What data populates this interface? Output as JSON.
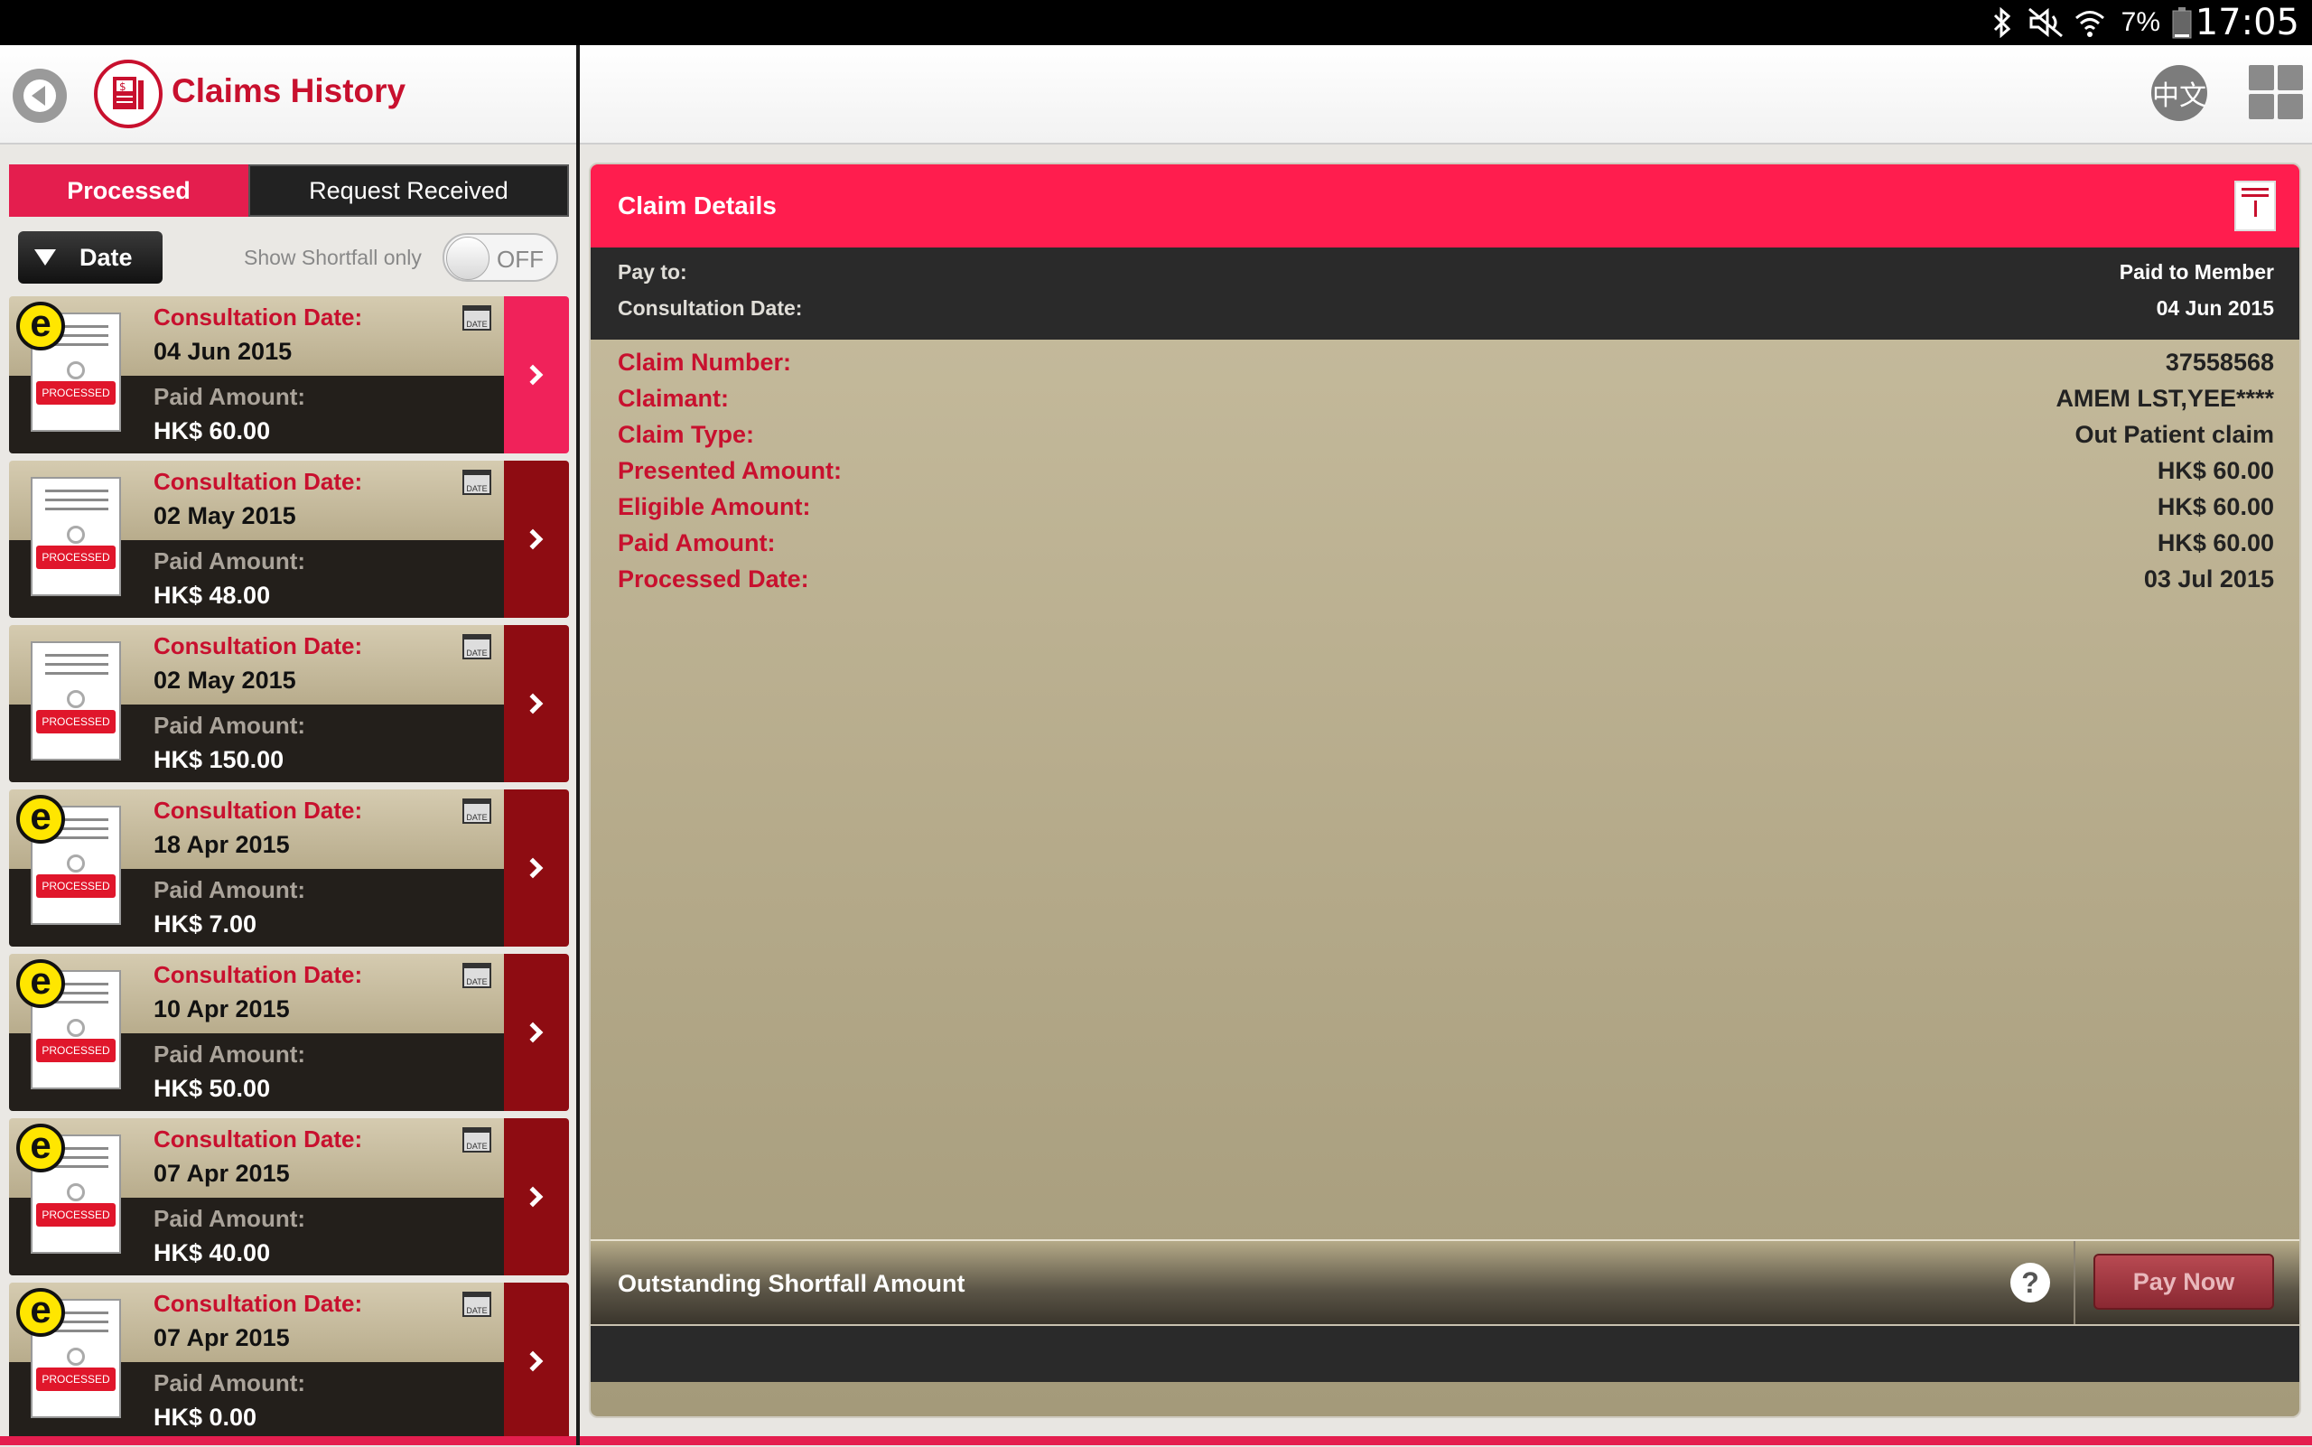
{
  "status_bar": {
    "time": "17:05",
    "battery_percent": "7%",
    "icons": [
      "bluetooth-icon",
      "mute-icon",
      "wifi-icon",
      "battery-icon"
    ]
  },
  "header": {
    "title": "Claims History",
    "lang_button": "中文"
  },
  "tabs": {
    "processed": "Processed",
    "request_received": "Request Received"
  },
  "filters": {
    "sort_label": "Date",
    "shortfall_label": "Show Shortfall only",
    "shortfall_toggle": "OFF"
  },
  "claims": [
    {
      "consultation_label": "Consultation Date:",
      "date": "04 Jun 2015",
      "paid_label": "Paid Amount:",
      "amount": "HK$ 60.00",
      "e_claim": true,
      "selected": true,
      "stamp": "PROCESSED",
      "cal": "DATE"
    },
    {
      "consultation_label": "Consultation Date:",
      "date": "02 May 2015",
      "paid_label": "Paid Amount:",
      "amount": "HK$ 48.00",
      "e_claim": false,
      "selected": false,
      "stamp": "PROCESSED",
      "cal": "DATE"
    },
    {
      "consultation_label": "Consultation Date:",
      "date": "02 May 2015",
      "paid_label": "Paid Amount:",
      "amount": "HK$ 150.00",
      "e_claim": false,
      "selected": false,
      "stamp": "PROCESSED",
      "cal": "DATE"
    },
    {
      "consultation_label": "Consultation Date:",
      "date": "18 Apr 2015",
      "paid_label": "Paid Amount:",
      "amount": "HK$ 7.00",
      "e_claim": true,
      "selected": false,
      "stamp": "PROCESSED",
      "cal": "DATE"
    },
    {
      "consultation_label": "Consultation Date:",
      "date": "10 Apr 2015",
      "paid_label": "Paid Amount:",
      "amount": "HK$ 50.00",
      "e_claim": true,
      "selected": false,
      "stamp": "PROCESSED",
      "cal": "DATE"
    },
    {
      "consultation_label": "Consultation Date:",
      "date": "07 Apr 2015",
      "paid_label": "Paid Amount:",
      "amount": "HK$ 40.00",
      "e_claim": true,
      "selected": false,
      "stamp": "PROCESSED",
      "cal": "DATE"
    },
    {
      "consultation_label": "Consultation Date:",
      "date": "07 Apr 2015",
      "paid_label": "Paid Amount:",
      "amount": "HK$ 0.00",
      "e_claim": true,
      "selected": false,
      "stamp": "PROCESSED",
      "cal": "DATE"
    }
  ],
  "details": {
    "title": "Claim Details",
    "pay_to_label": "Pay to:",
    "pay_to_value": "Paid to Member",
    "consultation_label": "Consultation Date:",
    "consultation_value": "04 Jun 2015",
    "rows": [
      {
        "label": "Claim Number:",
        "value": "37558568"
      },
      {
        "label": "Claimant:",
        "value": "AMEM LST,YEE****"
      },
      {
        "label": "Claim Type:",
        "value": "Out Patient claim"
      },
      {
        "label": "Presented Amount:",
        "value": "HK$ 60.00"
      },
      {
        "label": "Eligible Amount:",
        "value": "HK$ 60.00"
      },
      {
        "label": "Paid Amount:",
        "value": "HK$ 60.00"
      },
      {
        "label": "Processed Date:",
        "value": "03 Jul 2015"
      }
    ],
    "shortfall_title": "Outstanding Shortfall Amount",
    "help_symbol": "?",
    "pay_now": "Pay Now"
  },
  "colors": {
    "accent": "#e41e4e",
    "brand_red": "#c8102e",
    "dark": "#231f1b"
  }
}
